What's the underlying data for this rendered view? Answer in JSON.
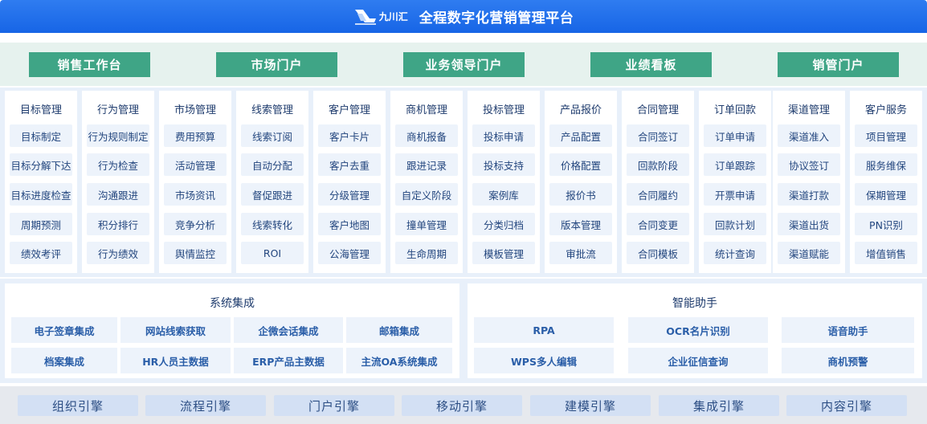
{
  "header": {
    "logo_text": "九川汇",
    "title": "全程数字化营销管理平台"
  },
  "portals": [
    "销售工作台",
    "市场门户",
    "业务领导门户",
    "业绩看板",
    "销管门户"
  ],
  "modules": [
    {
      "title": "目标管理",
      "items": [
        "目标制定",
        "目标分解下达",
        "目标进度检查",
        "周期预测",
        "绩效考评"
      ]
    },
    {
      "title": "行为管理",
      "items": [
        "行为规则制定",
        "行为检查",
        "沟通跟进",
        "积分排行",
        "行为绩效"
      ]
    },
    {
      "title": "市场管理",
      "items": [
        "费用预算",
        "活动管理",
        "市场资讯",
        "竞争分析",
        "舆情监控"
      ]
    },
    {
      "title": "线索管理",
      "items": [
        "线索订阅",
        "自动分配",
        "督促跟进",
        "线索转化",
        "ROI"
      ]
    },
    {
      "title": "客户管理",
      "items": [
        "客户卡片",
        "客户去重",
        "分级管理",
        "客户地图",
        "公海管理"
      ]
    },
    {
      "title": "商机管理",
      "items": [
        "商机报备",
        "跟进记录",
        "自定义阶段",
        "撞单管理",
        "生命周期"
      ]
    },
    {
      "title": "投标管理",
      "items": [
        "投标申请",
        "投标支持",
        "案例库",
        "分类归档",
        "模板管理"
      ]
    },
    {
      "title": "产品报价",
      "items": [
        "产品配置",
        "价格配置",
        "报价书",
        "版本管理",
        "审批流"
      ]
    },
    {
      "title": "合同管理",
      "items": [
        "合同签订",
        "回款阶段",
        "合同履约",
        "合同变更",
        "合同模板"
      ]
    },
    {
      "title": "订单回款",
      "items": [
        "订单申请",
        "订单跟踪",
        "开票申请",
        "回款计划",
        "统计查询"
      ]
    },
    {
      "title": "渠道管理",
      "items": [
        "渠道准入",
        "协议签订",
        "渠道打款",
        "渠道出货",
        "渠道赋能"
      ]
    },
    {
      "title": "客户服务",
      "items": [
        "项目管理",
        "服务维保",
        "保期管理",
        "PN识别",
        "增值销售"
      ]
    }
  ],
  "system_integration": {
    "title": "系统集成",
    "items": [
      "电子签章集成",
      "网站线索获取",
      "企微会话集成",
      "邮箱集成",
      "档案集成",
      "HR人员主数据",
      "ERP产品主数据",
      "主流OA系统集成"
    ]
  },
  "assistant": {
    "title": "智能助手",
    "items": [
      "RPA",
      "OCR名片识别",
      "语音助手",
      "WPS多人编辑",
      "企业征信查询",
      "商机预警"
    ]
  },
  "engines": [
    "组织引擎",
    "流程引擎",
    "门户引擎",
    "移动引擎",
    "建模引擎",
    "集成引擎",
    "内容引擎"
  ],
  "colors": {
    "header": "#1765e6",
    "portal_button": "#3fa586",
    "cell_text": "#23467e"
  }
}
